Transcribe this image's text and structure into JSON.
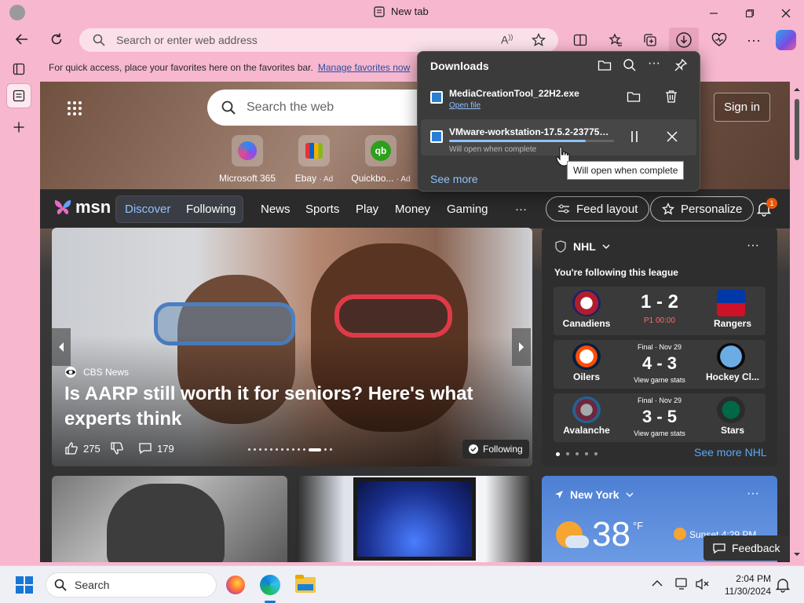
{
  "browser": {
    "tab_title": "New tab",
    "address_placeholder": "Search or enter web address",
    "favorites_bar_text": "For quick access, place your favorites here on the favorites bar.",
    "favorites_bar_link": "Manage favorites now"
  },
  "downloads": {
    "title": "Downloads",
    "items": [
      {
        "filename": "MediaCreationTool_22H2.exe",
        "action": "Open file"
      },
      {
        "filename": "VMware-workstation-17.5.2-23775571.exe",
        "status": "Will open when complete",
        "progress": 0.83
      }
    ],
    "see_more": "See more",
    "tooltip": "Will open when complete"
  },
  "newtab": {
    "search_placeholder": "Search the web",
    "signin": "Sign in",
    "tiles": [
      {
        "label": "Microsoft 365",
        "ad": ""
      },
      {
        "label": "Ebay",
        "ad": "· Ad"
      },
      {
        "label": "Quickbo...",
        "ad": "· Ad"
      }
    ]
  },
  "msn": {
    "brand": "msn",
    "tabs": [
      "Discover",
      "Following",
      "News",
      "Sports",
      "Play",
      "Money",
      "Gaming"
    ],
    "more": "···",
    "feed_layout": "Feed layout",
    "personalize": "Personalize",
    "notif_count": "1"
  },
  "hero": {
    "source": "CBS News",
    "title": "Is AARP still worth it for seniors? Here's what experts think",
    "likes": "275",
    "comments": "179",
    "following": "Following"
  },
  "nhl": {
    "league": "NHL",
    "subtitle": "You're following this league",
    "games": [
      {
        "home": "Canadiens",
        "away": "Rangers",
        "score": "1 - 2",
        "status": "P1 00:00",
        "label": ""
      },
      {
        "home": "Oilers",
        "away": "Hockey Cl...",
        "score": "4 - 3",
        "status": "Final · Nov 29",
        "label": "View game stats"
      },
      {
        "home": "Avalanche",
        "away": "Stars",
        "score": "3 - 5",
        "status": "Final · Nov 29",
        "label": "View game stats"
      }
    ],
    "see_more": "See more NHL"
  },
  "weather": {
    "city": "New York",
    "temp": "38",
    "unit": "°F",
    "sunset": "Sunset 4:29 PM"
  },
  "feedback": "Feedback",
  "taskbar": {
    "search": "Search",
    "time": "2:04 PM",
    "date": "11/30/2024"
  },
  "colors": {
    "frame": "#f7b7cf",
    "accent": "#0a66c2",
    "flyout": "#3b3b3b"
  }
}
